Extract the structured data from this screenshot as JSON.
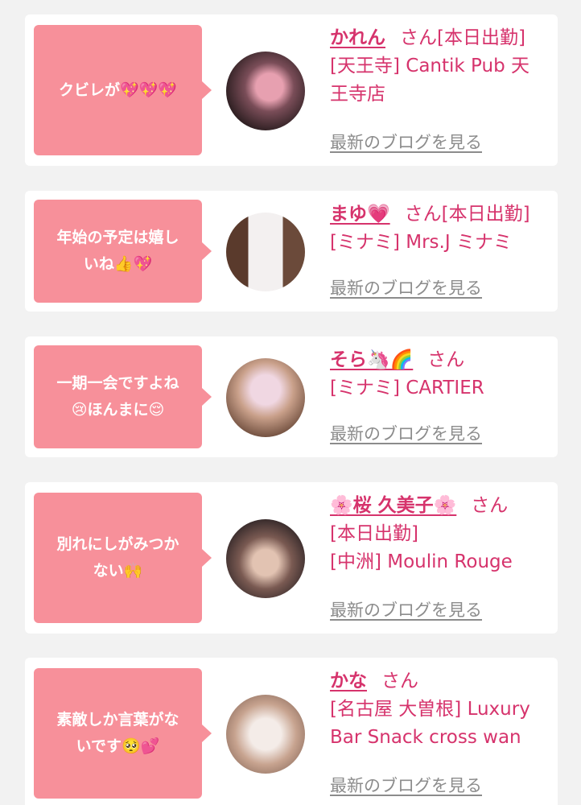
{
  "cards": [
    {
      "bubble_lines": [
        "クビレが💖💖💖"
      ],
      "name": "かれん",
      "honorific": "さん[本日出勤]",
      "shop_lines": [
        "[天王寺] Cantik Pub 天",
        "王寺店"
      ],
      "blog_link": "最新のブログを見る",
      "avatar_colors": [
        "#2a1d1f",
        "#e7a0b0"
      ]
    },
    {
      "bubble_lines": [
        "年始の予定は嬉し",
        "いね👍💖"
      ],
      "name": "まゆ💗",
      "honorific": "さん[本日出勤]",
      "shop_lines": [
        "[ミナミ] Mrs.J ミナミ"
      ],
      "blog_link": "最新のブログを見る",
      "avatar_colors": [
        "#6b4a3a",
        "#f1eeee"
      ]
    },
    {
      "bubble_lines": [
        "一期一会ですよね",
        "😢ほんまに😌"
      ],
      "name": "そら🦄🌈",
      "honorific": "さん",
      "shop_lines": [
        "[ミナミ] CARTIER"
      ],
      "blog_link": "最新のブログを見る",
      "avatar_colors": [
        "#8a6a55",
        "#e7cbd6"
      ]
    },
    {
      "bubble_lines": [
        "別れにしがみつか",
        "ない🙌"
      ],
      "name": "🌸桜 久美子🌸",
      "honorific": "さん",
      "shop_lines": [
        "[本日出勤]",
        "[中洲] Moulin Rouge"
      ],
      "blog_link": "最新のブログを見る",
      "avatar_colors": [
        "#3b2c2e",
        "#d9b9a8"
      ]
    },
    {
      "bubble_lines": [
        "素敵しか言葉がな",
        "いです🥺💕"
      ],
      "name": "かな",
      "honorific": "さん",
      "shop_lines": [
        "[名古屋 大曽根] Luxury",
        "Bar Snack cross wan"
      ],
      "blog_link": "最新のブログを見る",
      "avatar_colors": [
        "#caa592",
        "#f4ece8"
      ]
    }
  ]
}
